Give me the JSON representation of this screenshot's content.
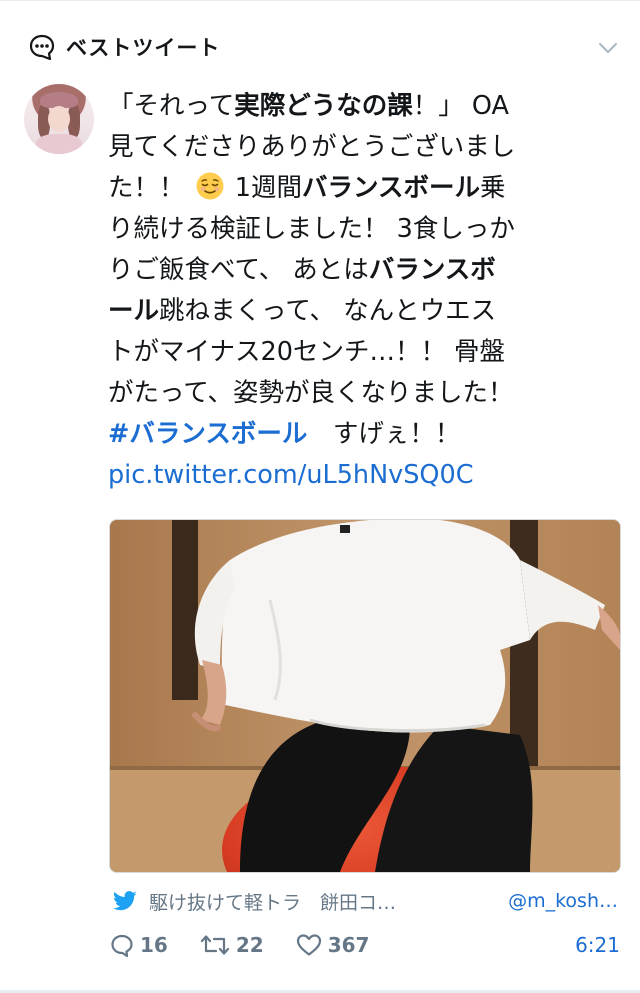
{
  "header": {
    "label": "ベストツイート",
    "icon": "chat-bubble-icon",
    "menu_icon": "chevron-down-icon"
  },
  "author": {
    "avatar": "avatar"
  },
  "tweet": {
    "lines": [
      [
        "「それって",
        "実際どうなの課",
        "！」 OA"
      ],
      [
        "見てくださりありがとうございまし"
      ],
      [
        "た！！",
        "1週間",
        "バランスボール",
        "乗"
      ],
      [
        "り続ける検証しました！ 3食しっか"
      ],
      [
        "りご飯食べて、 あとは",
        "バランスボ"
      ],
      [
        "ール",
        "跳ねまくって、 なんとウエス"
      ],
      [
        "トがマイナス20センチ…！！ 骨盤"
      ],
      [
        "がたって、姿勢が良くなりました！"
      ],
      [
        "#バランスボール",
        "　すげぇ！！"
      ],
      [
        "pic.twitter.com/uL5hNvSQ0C"
      ]
    ],
    "emoji": "relieved-face-icon"
  },
  "media": {
    "alt": "photo"
  },
  "source": {
    "icon": "twitter-bird-icon",
    "name": "駆け抜けて軽トラ　餅田コ…",
    "handle": "@m_kosh…"
  },
  "actions": {
    "reply_count": "16",
    "retweet_count": "22",
    "like_count": "367",
    "time": "6:21"
  },
  "colors": {
    "link": "#1b6dd1",
    "muted": "#657786",
    "text": "#14171a"
  }
}
